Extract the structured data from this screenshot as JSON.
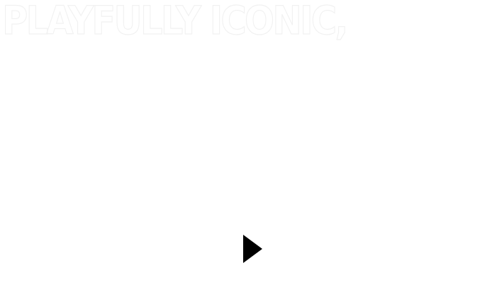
{
  "hero": {
    "headline": "PLAYFULLY ICONIC,"
  },
  "controls": {
    "play_icon": "play-icon"
  },
  "colors": {
    "background": "#ffffff",
    "headline_fill": "#ffffff",
    "headline_outline": "#f1f1f1",
    "play_icon": "#000000"
  }
}
